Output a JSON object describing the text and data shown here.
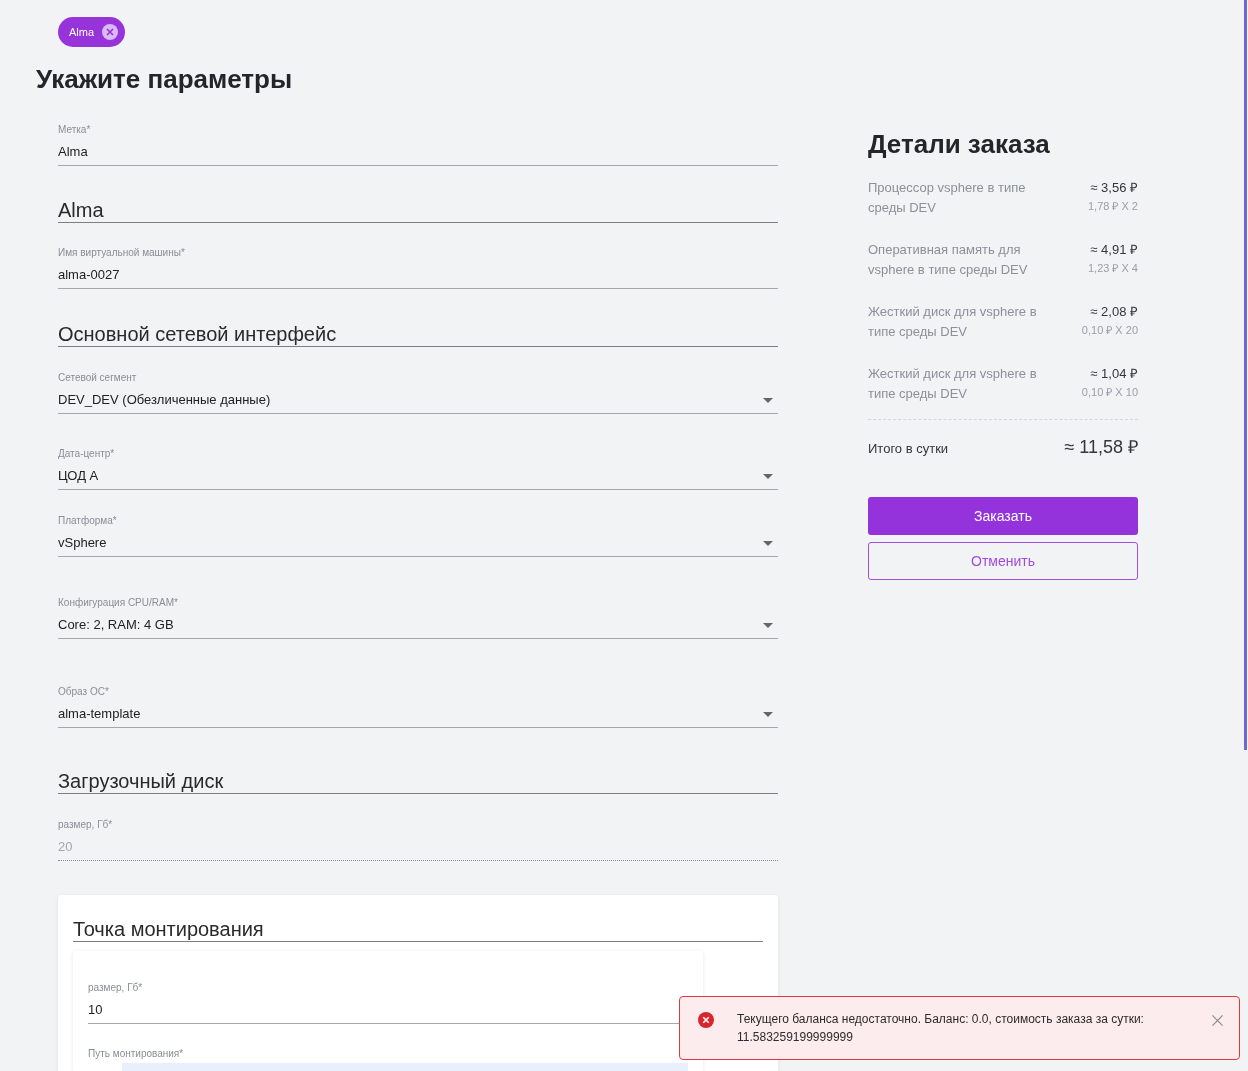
{
  "tag_chip": {
    "label": "Alma"
  },
  "page_title": "Укажите параметры",
  "form_items": [
    {
      "kind": "field",
      "label": "Метка*",
      "value": "Alma",
      "disabled": false
    },
    {
      "kind": "heading",
      "text": "Alma"
    },
    {
      "kind": "field",
      "label": "Имя виртуальной машины*",
      "value": "alma-0027",
      "disabled": false
    },
    {
      "kind": "heading",
      "text": "Основной сетевой интерфейс"
    },
    {
      "kind": "select",
      "label": "Сетевой сегмент",
      "value": "DEV_DEV (Обезличенные данные)",
      "disabled": false
    },
    {
      "kind": "select",
      "label": "Дата-центр*",
      "value": "ЦОД А",
      "disabled": false
    },
    {
      "kind": "select",
      "label": "Платформа*",
      "value": "vSphere",
      "disabled": false
    },
    {
      "kind": "select",
      "label": "Конфигурация CPU/RAM*",
      "value": "Core: 2, RAM: 4 GB",
      "disabled": false
    },
    {
      "kind": "select",
      "label": "Образ ОС*",
      "value": "alma-template",
      "disabled": false
    },
    {
      "kind": "heading",
      "text": "Загрузочный диск"
    },
    {
      "kind": "field",
      "label": "размер, Гб*",
      "value": "20",
      "disabled": true
    }
  ],
  "mount_point_card": {
    "title": "Точка монтирования",
    "fields": [
      {
        "kind": "field",
        "label": "размер, Гб*",
        "value": "10",
        "disabled": false
      },
      {
        "kind": "box",
        "label": "Путь монтирования*",
        "disabled": false
      }
    ]
  },
  "order_details": {
    "title": "Детали заказа",
    "items": [
      {
        "name": "Процессор vsphere в типе среды DEV",
        "price": "≈ 3,56 ₽",
        "calc": "1,78 ₽ X 2"
      },
      {
        "name": "Оперативная память для vsphere в типе среды DEV",
        "price": "≈ 4,91 ₽",
        "calc": "1,23 ₽ X 4"
      },
      {
        "name": "Жесткий диск для vsphere в типе среды DEV",
        "price": "≈ 2,08 ₽",
        "calc": "0,10 ₽ X 20"
      },
      {
        "name": "Жесткий диск для vsphere в типе среды DEV",
        "price": "≈ 1,04 ₽",
        "calc": "0,10 ₽ X 10"
      }
    ],
    "total_label": "Итого в сутки",
    "total": "≈ 11,58 ₽",
    "buttons": [
      {
        "label": "Заказать",
        "kind": "primary"
      },
      {
        "label": "Отменить",
        "kind": "outline"
      }
    ]
  },
  "notification": {
    "kind": "error",
    "message": "Текущего баланса недостаточно. Баланс: 0.0, стоимость заказа за сутки: 11.583259199999999"
  }
}
